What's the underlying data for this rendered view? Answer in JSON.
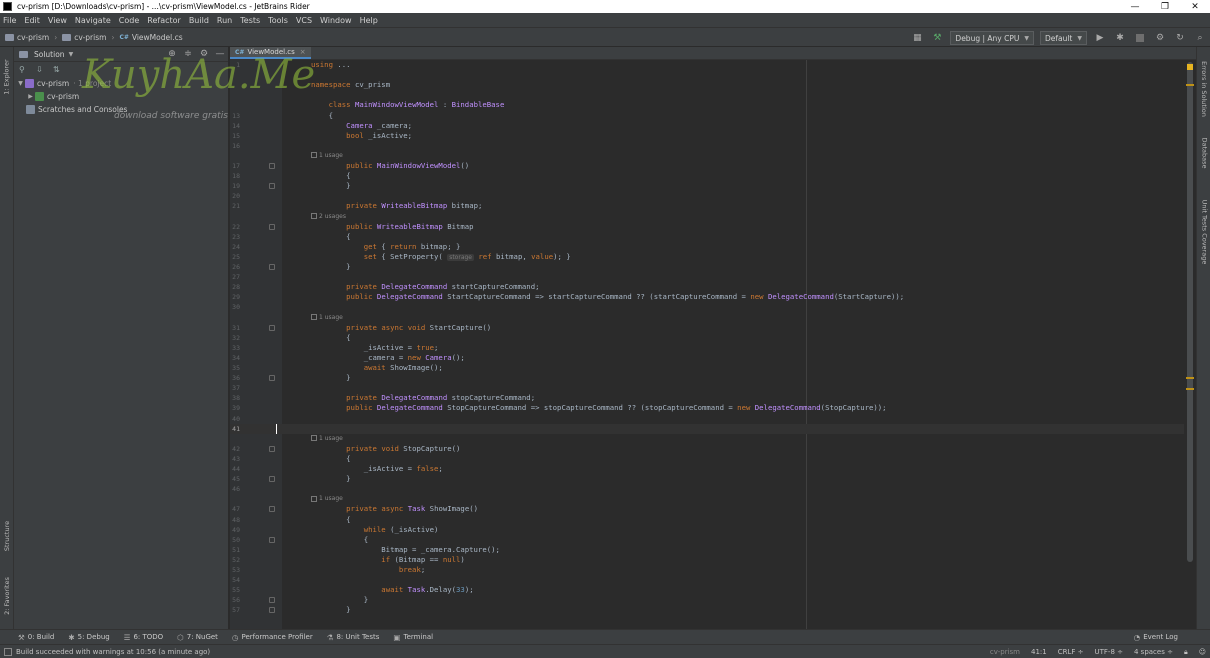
{
  "window": {
    "title": "cv-prism [D:\\Downloads\\cv-prism] - ...\\cv-prism\\ViewModel.cs - JetBrains Rider",
    "minimize": "—",
    "maximize": "❐",
    "close": "✕"
  },
  "menu": [
    "File",
    "Edit",
    "View",
    "Navigate",
    "Code",
    "Refactor",
    "Build",
    "Run",
    "Tests",
    "Tools",
    "VCS",
    "Window",
    "Help"
  ],
  "breadcrumbs": [
    "cv-prism",
    "cv-prism",
    "ViewModel.cs"
  ],
  "toolbar": {
    "config": "Debug | Any CPU",
    "profile": "Default"
  },
  "explorer": {
    "title": "Solution",
    "tree": [
      {
        "label": "cv-prism",
        "note": "· 1 project"
      },
      {
        "label": "cv-prism",
        "note": ""
      },
      {
        "label": "Scratches and Consoles",
        "note": ""
      }
    ]
  },
  "watermark": {
    "brand": "KuyhAa.Me",
    "tagline": "download software gratis"
  },
  "left_tabs": [
    "1: Explorer",
    "Structure",
    "2: Favorites"
  ],
  "right_tabs": [
    "Errors in Solution",
    "Database",
    "Unit Tests Coverage"
  ],
  "editor": {
    "tab_label": "ViewModel.cs",
    "tab_icon": "C#",
    "current_line": "41",
    "lines": [
      {
        "n": "1",
        "code": "using ..."
      },
      {
        "n": "",
        "code": ""
      },
      {
        "n": "",
        "code": "namespace cv_prism"
      },
      {
        "n": "",
        "code": ""
      },
      {
        "n": "",
        "code": "    class MainWindowViewModel : BindableBase"
      },
      {
        "n": "13",
        "code": "    {"
      },
      {
        "n": "14",
        "code": "        Camera _camera;"
      },
      {
        "n": "15",
        "code": "        bool _isActive;"
      },
      {
        "n": "16",
        "code": ""
      },
      {
        "n": "17",
        "code": "        public MainWindowViewModel()"
      },
      {
        "n": "18",
        "code": "        {"
      },
      {
        "n": "19",
        "code": "        }"
      },
      {
        "n": "20",
        "code": ""
      },
      {
        "n": "21",
        "code": "        private WriteableBitmap bitmap;"
      },
      {
        "n": "22",
        "code": "        public WriteableBitmap Bitmap"
      },
      {
        "n": "23",
        "code": "        {"
      },
      {
        "n": "24",
        "code": "            get { return bitmap; }"
      },
      {
        "n": "25",
        "code": "            set { SetProperty( ref bitmap, value); }"
      },
      {
        "n": "26",
        "code": "        }"
      },
      {
        "n": "27",
        "code": ""
      },
      {
        "n": "28",
        "code": "        private DelegateCommand startCaptureCommand;"
      },
      {
        "n": "29",
        "code": "        public DelegateCommand StartCaptureCommand => startCaptureCommand ?? (startCaptureCommand = new DelegateCommand(StartCapture));"
      },
      {
        "n": "30",
        "code": ""
      },
      {
        "n": "31",
        "code": "        private async void StartCapture()"
      },
      {
        "n": "32",
        "code": "        {"
      },
      {
        "n": "33",
        "code": "            _isActive = true;"
      },
      {
        "n": "34",
        "code": "            _camera = new Camera();"
      },
      {
        "n": "35",
        "code": "            await ShowImage();"
      },
      {
        "n": "36",
        "code": "        }"
      },
      {
        "n": "37",
        "code": ""
      },
      {
        "n": "38",
        "code": "        private DelegateCommand stopCaptureCommand;"
      },
      {
        "n": "39",
        "code": "        public DelegateCommand StopCaptureCommand => stopCaptureCommand ?? (stopCaptureCommand = new DelegateCommand(StopCapture));"
      },
      {
        "n": "40",
        "code": ""
      },
      {
        "n": "41",
        "code": ""
      },
      {
        "n": "42",
        "code": "        private void StopCapture()"
      },
      {
        "n": "43",
        "code": "        {"
      },
      {
        "n": "44",
        "code": "            _isActive = false;"
      },
      {
        "n": "45",
        "code": "        }"
      },
      {
        "n": "46",
        "code": ""
      },
      {
        "n": "47",
        "code": "        private async Task ShowImage()"
      },
      {
        "n": "48",
        "code": "        {"
      },
      {
        "n": "49",
        "code": "            while (_isActive)"
      },
      {
        "n": "50",
        "code": "            {"
      },
      {
        "n": "51",
        "code": "                Bitmap = _camera.Capture();"
      },
      {
        "n": "52",
        "code": "                if (Bitmap == null)"
      },
      {
        "n": "53",
        "code": "                    break;"
      },
      {
        "n": "54",
        "code": ""
      },
      {
        "n": "55",
        "code": "                await Task.Delay(33);"
      },
      {
        "n": "56",
        "code": "            }"
      },
      {
        "n": "57",
        "code": "        }"
      }
    ],
    "hints": [
      {
        "before_line": "17",
        "text": "1 usage"
      },
      {
        "before_line": "22",
        "text": "2 usages"
      },
      {
        "before_line": "31",
        "text": "1 usage"
      },
      {
        "before_line": "42",
        "text": "1 usage"
      },
      {
        "before_line": "47",
        "text": "1 usage"
      }
    ],
    "param_hint": "storage"
  },
  "tool_windows": [
    {
      "icon": "hammer-icon",
      "label": "0: Build"
    },
    {
      "icon": "bug-icon",
      "label": "5: Debug"
    },
    {
      "icon": "todo-icon",
      "label": "6: TODO"
    },
    {
      "icon": "nuget-icon",
      "label": "7: NuGet"
    },
    {
      "icon": "profiler-icon",
      "label": "Performance Profiler"
    },
    {
      "icon": "unit-tests-icon",
      "label": "8: Unit Tests"
    },
    {
      "icon": "terminal-icon",
      "label": "Terminal"
    }
  ],
  "event_log": "Event Log",
  "status": {
    "message": "Build succeeded with warnings at 10:56 (a minute ago)",
    "context": "cv-prism",
    "position": "41:1",
    "line_sep": "CRLF ÷",
    "encoding": "UTF-8 ÷",
    "indent": "4 spaces ÷"
  },
  "colors": {
    "accent": "#4a88c7",
    "keyword": "#cc7832",
    "class": "#c191ff",
    "number": "#6897bb"
  }
}
